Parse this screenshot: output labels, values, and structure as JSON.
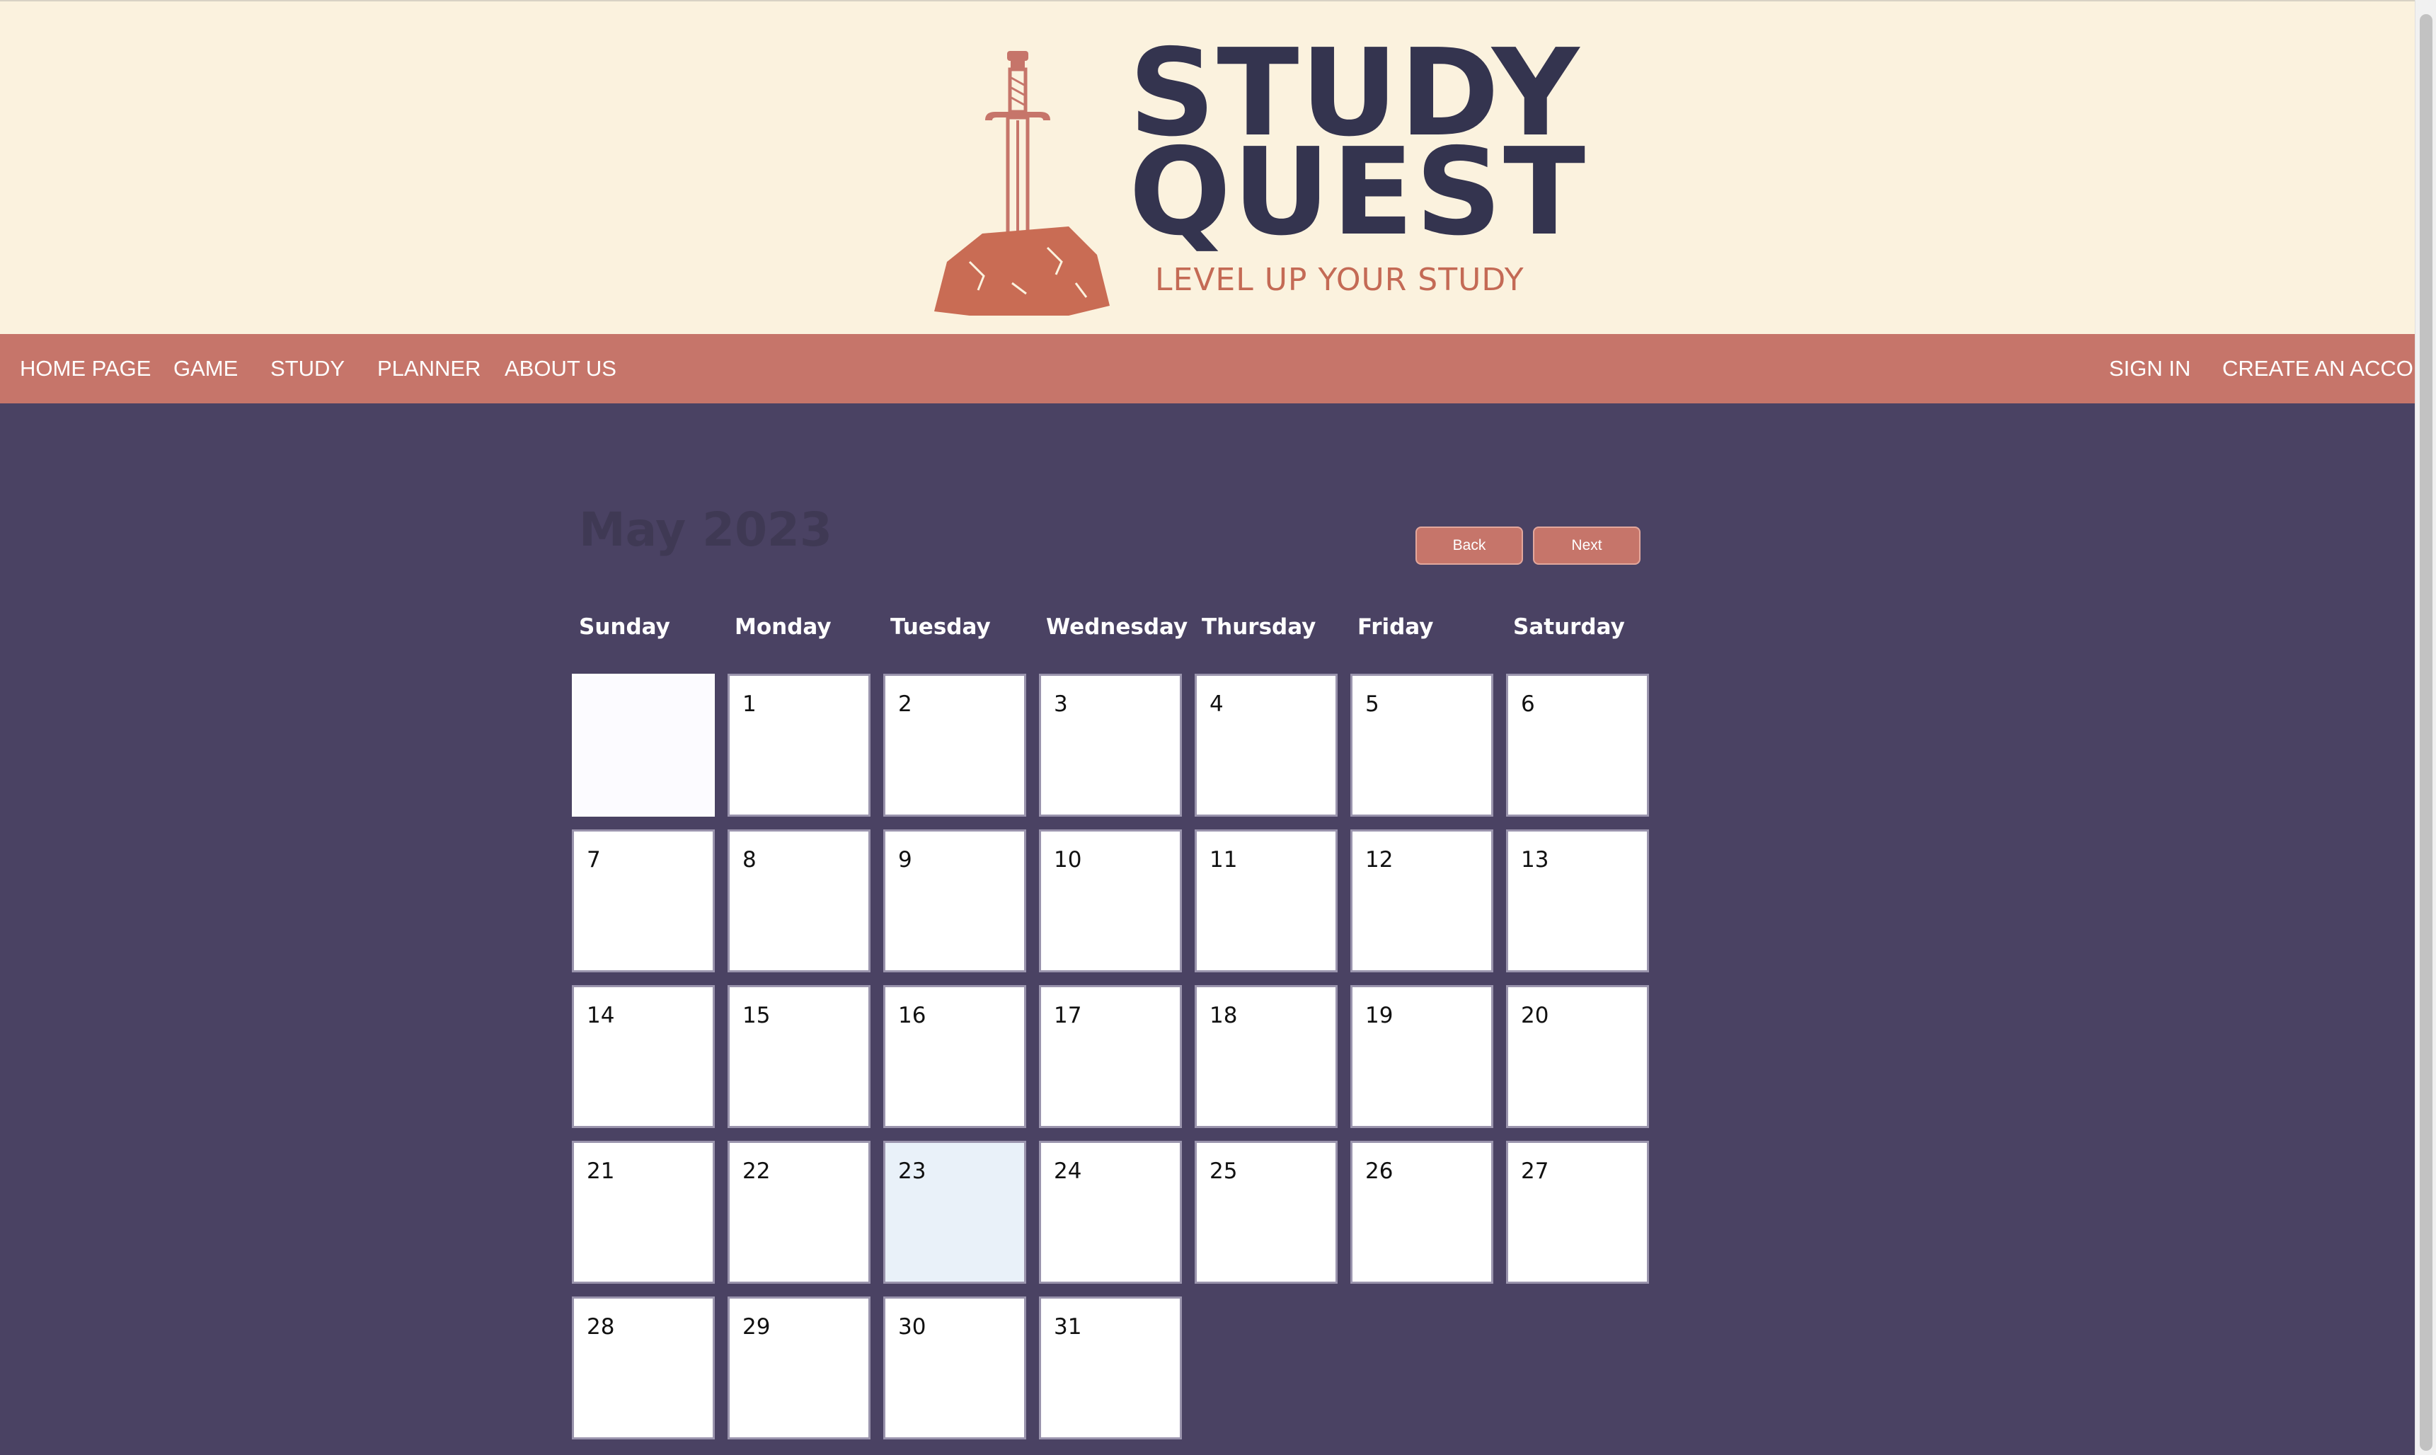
{
  "brand": {
    "title_line1": "STUDY",
    "title_line2": "QUEST",
    "tagline": "LEVEL UP YOUR STUDY",
    "logo_icon": "sword-in-stone-icon",
    "colors": {
      "navy": "#34344f",
      "coral": "#c46a55",
      "cream": "#fbf2de"
    }
  },
  "nav": {
    "left": [
      "HOME PAGE",
      "GAME",
      "STUDY",
      "PLANNER",
      "ABOUT US"
    ],
    "right": [
      "SIGN IN",
      "CREATE AN ACCOUNT"
    ],
    "background": "#c6756a"
  },
  "calendar": {
    "month_label": "May 2023",
    "back_label": "Back",
    "next_label": "Next",
    "weekdays": [
      "Sunday",
      "Monday",
      "Tuesday",
      "Wednesday",
      "Thursday",
      "Friday",
      "Saturday"
    ],
    "weeks": [
      [
        "",
        "1",
        "2",
        "3",
        "4",
        "5",
        "6"
      ],
      [
        "7",
        "8",
        "9",
        "10",
        "11",
        "12",
        "13"
      ],
      [
        "14",
        "15",
        "16",
        "17",
        "18",
        "19",
        "20"
      ],
      [
        "21",
        "22",
        "23",
        "24",
        "25",
        "26",
        "27"
      ],
      [
        "28",
        "29",
        "30",
        "31"
      ]
    ],
    "today": "23",
    "colors": {
      "page_bg": "#4a4263",
      "today_bg": "#e9f1f9",
      "button": "#c6756a"
    }
  }
}
